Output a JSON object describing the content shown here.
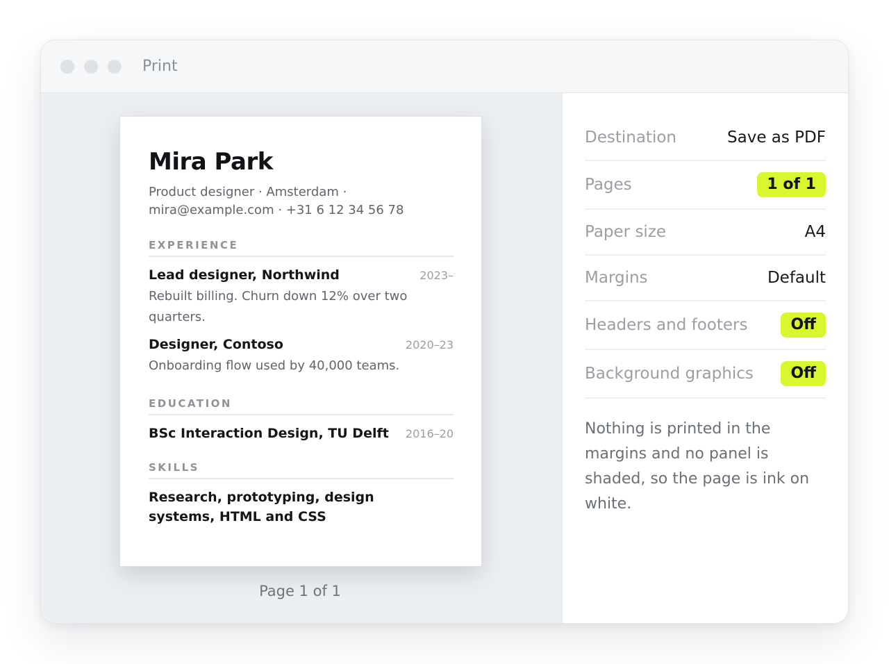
{
  "window": {
    "title": "Print"
  },
  "preview": {
    "name": "Mira Park",
    "contact": "Product designer · Amsterdam · mira@example.com · +31 6 12 34 56 78",
    "sections": {
      "experience": {
        "heading": "EXPERIENCE",
        "entries": [
          {
            "title": "Lead designer, Northwind",
            "date": "2023–",
            "desc": "Rebuilt billing. Churn down 12% over two quarters."
          },
          {
            "title": "Designer, Contoso",
            "date": "2020–23",
            "desc": "Onboarding flow used by 40,000 teams."
          }
        ]
      },
      "education": {
        "heading": "EDUCATION",
        "entries": [
          {
            "title": "BSc Interaction Design, TU Delft",
            "date": "2016–20"
          }
        ]
      },
      "skills": {
        "heading": "SKILLS",
        "text": "Research, prototyping, design systems, HTML and CSS"
      }
    },
    "page_caption": "Page 1 of 1"
  },
  "settings": {
    "destination": {
      "label": "Destination",
      "value": "Save as PDF"
    },
    "pages": {
      "label": "Pages",
      "value": "1 of 1"
    },
    "paper_size": {
      "label": "Paper size",
      "value": "A4"
    },
    "margins": {
      "label": "Margins",
      "value": "Default"
    },
    "headers_footers": {
      "label": "Headers and footers",
      "value": "Off"
    },
    "background_graphics": {
      "label": "Background graphics",
      "value": "Off"
    },
    "note": "Nothing is printed in the margins and no panel is shaded, so the page is ink on white."
  },
  "colors": {
    "accent": "#d9f62e",
    "preview_background": "#edf0f3",
    "window_dots": "#dfe2e5"
  }
}
